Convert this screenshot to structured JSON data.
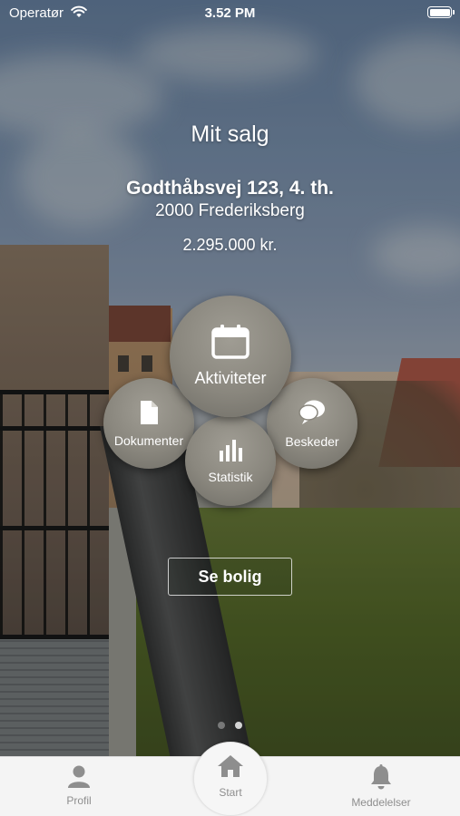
{
  "status_bar": {
    "carrier": "Operatør",
    "time": "3.52 PM",
    "wifi_icon": "wifi-icon",
    "battery_icon": "battery-icon"
  },
  "sale": {
    "title": "Mit salg",
    "address_line1": "Godthåbsvej 123, 4. th.",
    "address_line2": "2000 Frederiksberg",
    "price": "2.295.000 kr."
  },
  "menu": {
    "aktiviteter": {
      "label": "Aktiviteter",
      "icon": "calendar-icon"
    },
    "dokumenter": {
      "label": "Dokumenter",
      "icon": "document-icon"
    },
    "statistik": {
      "label": "Statistik",
      "icon": "bar-chart-icon"
    },
    "beskeder": {
      "label": "Beskeder",
      "icon": "chat-bubble-icon"
    }
  },
  "see_property_button": {
    "label": "Se bolig"
  },
  "pager": {
    "pages": 2,
    "active_page": 2
  },
  "tabbar": {
    "profil": {
      "label": "Profil",
      "icon": "person-icon"
    },
    "start": {
      "label": "Start",
      "icon": "home-icon"
    },
    "meddelelser": {
      "label": "Meddelelser",
      "icon": "bell-icon"
    }
  },
  "colors": {
    "circle": "#8a877e",
    "tabbar_bg": "#f4f4f4",
    "tab_icon": "#8e8e8e"
  }
}
